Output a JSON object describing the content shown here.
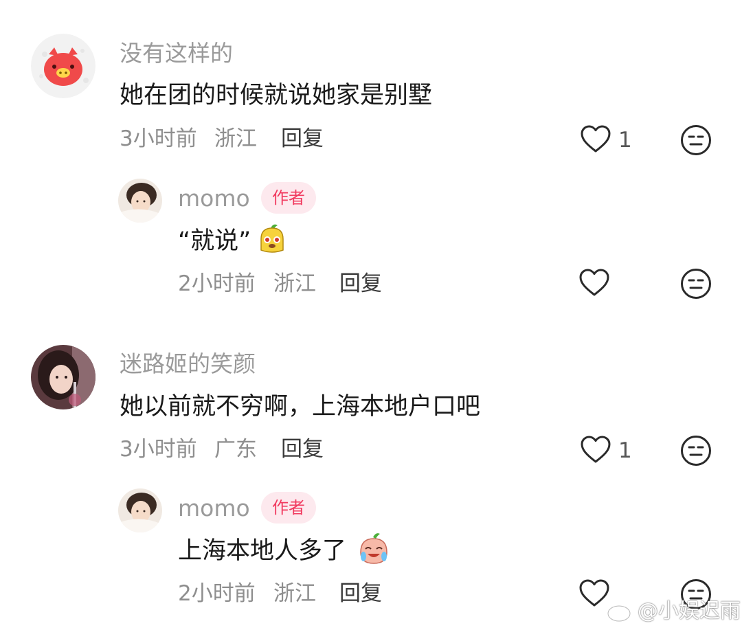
{
  "comments": [
    {
      "user": "没有这样的",
      "text": "她在团的时候就说她家是别墅",
      "time": "3小时前",
      "location": "浙江",
      "reply_label": "回复",
      "likes": "1",
      "reply": {
        "user": "momo",
        "badge": "作者",
        "text": "“就说”",
        "time": "2小时前",
        "location": "浙江",
        "reply_label": "回复"
      }
    },
    {
      "user": "迷路姬的笑颜",
      "text": "她以前就不穷啊，上海本地户口吧",
      "time": "3小时前",
      "location": "广东",
      "reply_label": "回复",
      "likes": "1",
      "reply": {
        "user": "momo",
        "badge": "作者",
        "text": "上海本地人多了",
        "time": "2小时前",
        "location": "浙江",
        "reply_label": "回复"
      }
    }
  ],
  "watermark": "@小娱迟雨",
  "icons": {
    "like": "heart-outline-icon",
    "dislike": "neutral-face-icon",
    "emoji1": "yellow-mascot-emoji",
    "emoji2": "crying-peach-emoji"
  },
  "colors": {
    "badge_bg": "#fde9ee",
    "badge_text": "#f13a5f",
    "avatar_pig": "#f04a4a"
  }
}
